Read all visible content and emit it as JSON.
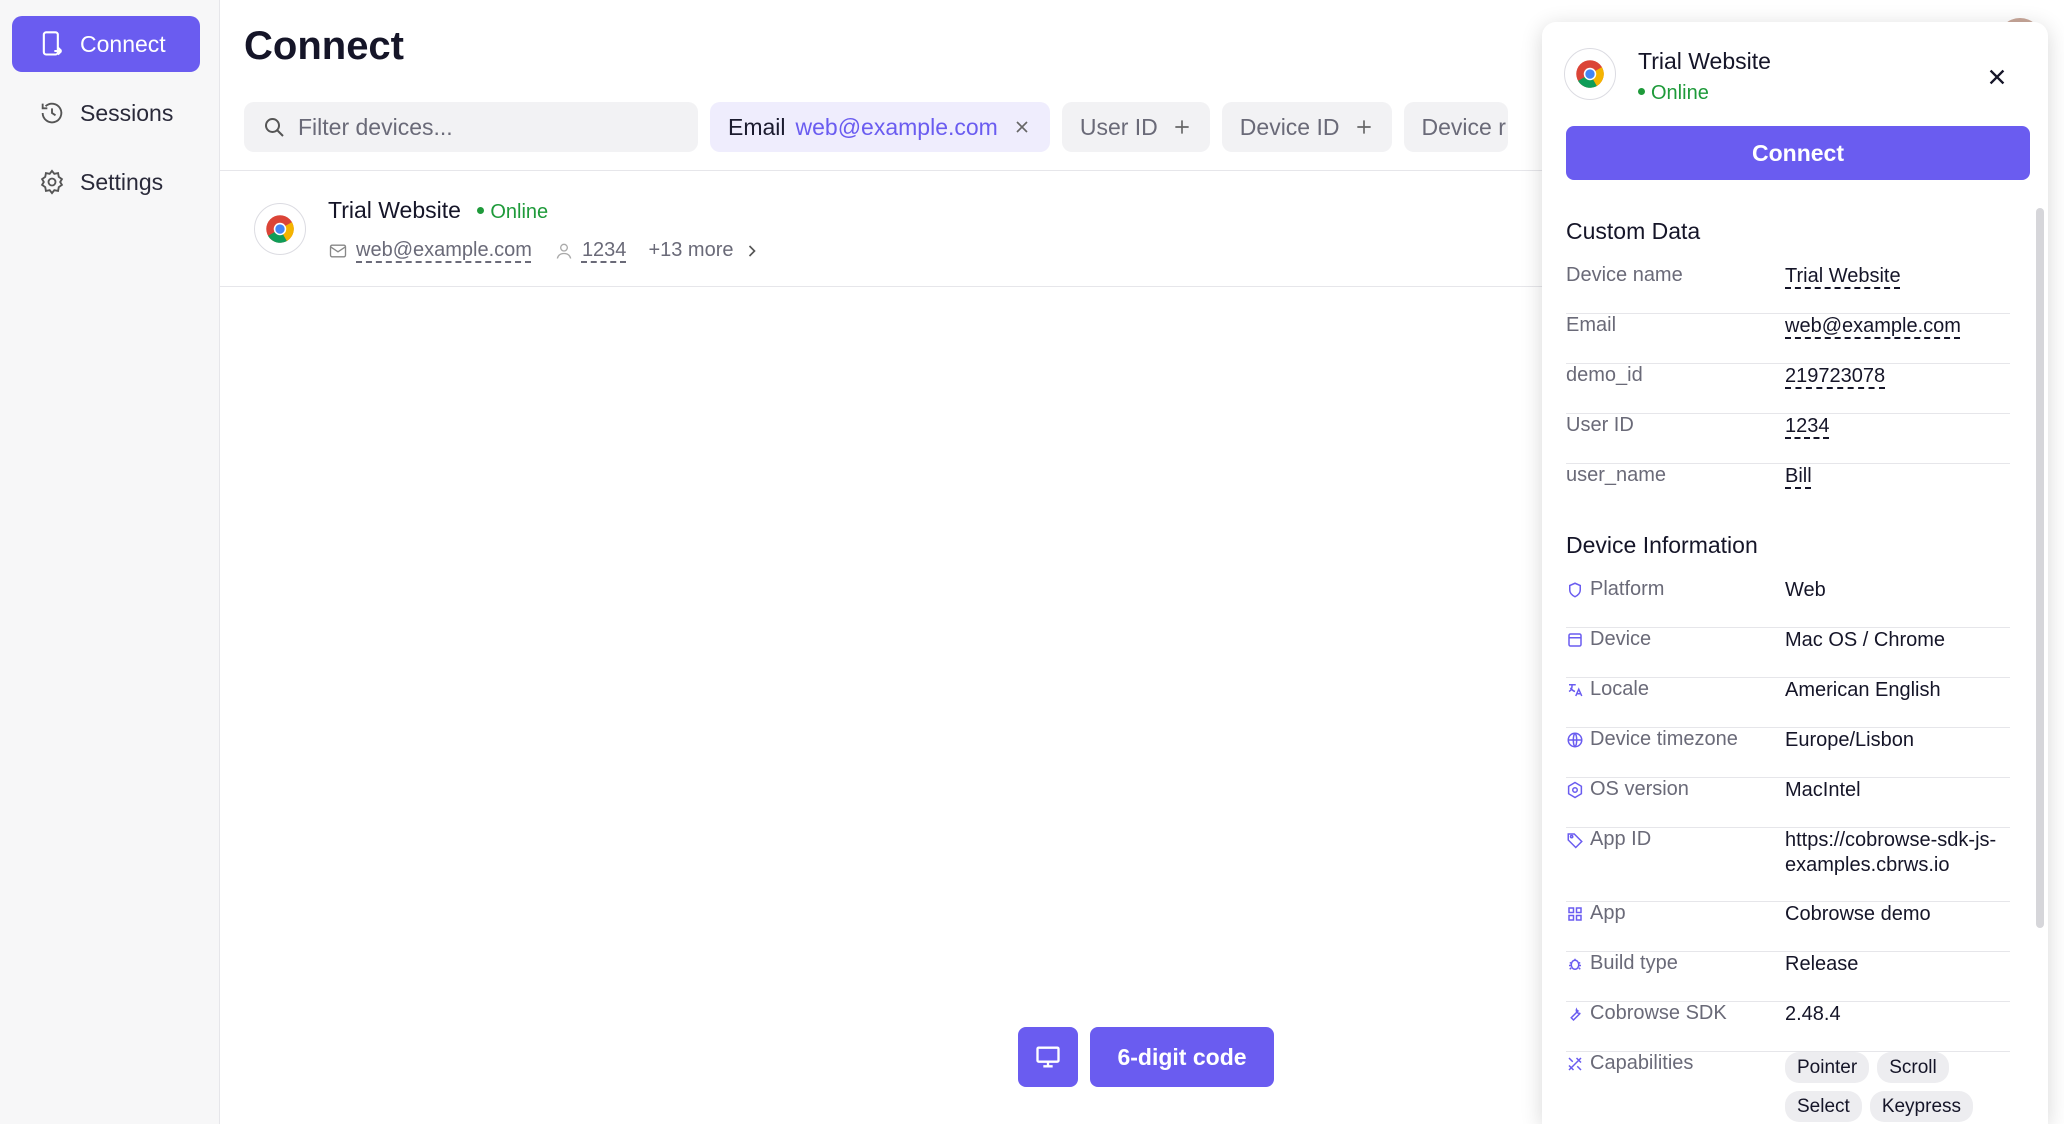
{
  "sidebar": {
    "items": [
      {
        "label": "Connect",
        "icon": "phone-connect-icon",
        "active": true
      },
      {
        "label": "Sessions",
        "icon": "history-icon",
        "active": false
      },
      {
        "label": "Settings",
        "icon": "gear-icon",
        "active": false
      }
    ]
  },
  "page": {
    "title": "Connect"
  },
  "filters": {
    "search_placeholder": "Filter devices...",
    "chips": [
      {
        "label": "Email",
        "value": "web@example.com",
        "active": true
      },
      {
        "label": "User ID"
      },
      {
        "label": "Device ID"
      },
      {
        "label": "Device r"
      }
    ]
  },
  "device_row": {
    "name": "Trial Website",
    "status": "Online",
    "email": "web@example.com",
    "user_id": "1234",
    "more": "+13 more"
  },
  "bottom": {
    "code_button": "6-digit code"
  },
  "panel": {
    "title": "Trial Website",
    "status": "Online",
    "connect_label": "Connect",
    "custom_data_title": "Custom Data",
    "custom_data": [
      {
        "key": "Device name",
        "value": "Trial Website"
      },
      {
        "key": "Email",
        "value": "web@example.com"
      },
      {
        "key": "demo_id",
        "value": "219723078"
      },
      {
        "key": "User ID",
        "value": "1234"
      },
      {
        "key": "user_name",
        "value": "Bill"
      }
    ],
    "device_info_title": "Device Information",
    "device_info": [
      {
        "key": "Platform",
        "value": "Web",
        "icon": "shield-icon"
      },
      {
        "key": "Device",
        "value": "Mac OS / Chrome",
        "icon": "window-icon"
      },
      {
        "key": "Locale",
        "value": "American English",
        "icon": "translate-icon"
      },
      {
        "key": "Device timezone",
        "value": "Europe/Lisbon",
        "icon": "globe-icon"
      },
      {
        "key": "OS version",
        "value": "MacIntel",
        "icon": "hexagon-icon"
      },
      {
        "key": "App ID",
        "value": "https://cobrowse-sdk-js-examples.cbrws.io",
        "icon": "tag-icon"
      },
      {
        "key": "App",
        "value": "Cobrowse demo",
        "icon": "apps-icon"
      },
      {
        "key": "Build type",
        "value": "Release",
        "icon": "bug-icon"
      },
      {
        "key": "Cobrowse SDK",
        "value": "2.48.4",
        "icon": "wrench-icon"
      },
      {
        "key": "Capabilities",
        "icon": "tools-icon"
      }
    ],
    "capabilities": [
      "Pointer",
      "Scroll",
      "Select",
      "Keypress"
    ]
  },
  "colors": {
    "accent": "#6a5cf0",
    "online": "#1e9a3a"
  }
}
